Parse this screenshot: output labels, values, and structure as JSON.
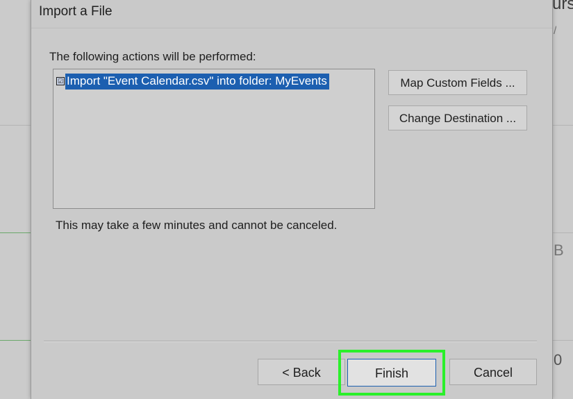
{
  "background_app": {
    "partial_text": "urs",
    "fragment_2": "/",
    "fragment_3": "B",
    "fragment_4": "0"
  },
  "dialog": {
    "title": "Import a File",
    "actions_label": "The following actions will be performed:",
    "actions": [
      {
        "checked": true,
        "checkbox_glyph": "☑",
        "label": "Import \"Event Calendar.csv\" into folder: MyEvents",
        "selected": true
      }
    ],
    "map_fields_label": "Map Custom Fields ...",
    "change_destination_label": "Change Destination ...",
    "note": "This may take a few minutes and cannot be canceled.",
    "back_label": "< Back",
    "finish_label": "Finish",
    "cancel_label": "Cancel"
  },
  "colors": {
    "selection": "#1c5fb0",
    "highlight_outline": "#2af02a",
    "dialog_bg": "#cbcbcb"
  }
}
